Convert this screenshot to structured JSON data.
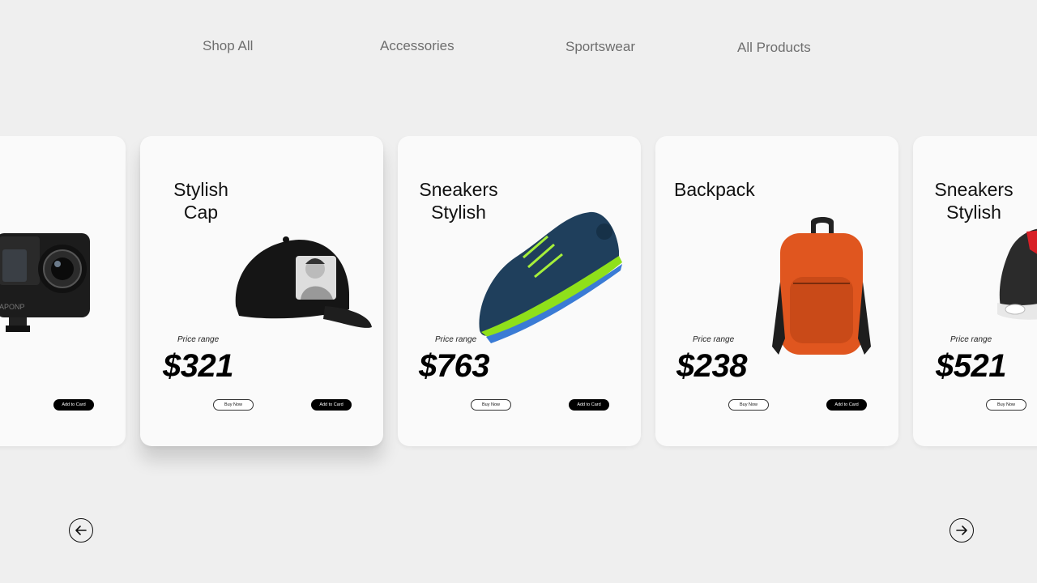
{
  "nav": {
    "items": [
      {
        "label": "Shop All"
      },
      {
        "label": "Accessories"
      },
      {
        "label": "Sportswear"
      },
      {
        "label": "All Products"
      }
    ]
  },
  "cards": [
    {
      "name": "Action Camera",
      "title_lines": [],
      "price_label": "",
      "price": "",
      "buy_label": "",
      "add_label": "Add to Card"
    },
    {
      "name": "Stylish Cap",
      "title_lines": [
        "Stylish",
        "Cap"
      ],
      "price_label": "Price range",
      "price": "$321",
      "buy_label": "Buy Now",
      "add_label": "Add to Card"
    },
    {
      "name": "Sneakers Stylish",
      "title_lines": [
        "Sneakers",
        "Stylish"
      ],
      "price_label": "Price range",
      "price": "$763",
      "buy_label": "Buy Now",
      "add_label": "Add to Card"
    },
    {
      "name": "Backpack",
      "title_lines": [
        "Backpack"
      ],
      "price_label": "Price range",
      "price": "$238",
      "buy_label": "Buy Now",
      "add_label": "Add to Card"
    },
    {
      "name": "Sneakers Stylish",
      "title_lines": [
        "Sneakers",
        "Stylish"
      ],
      "price_label": "Price range",
      "price": "$521",
      "buy_label": "Buy Now",
      "add_label": ""
    }
  ],
  "icons": {
    "prev": "arrow-left-icon",
    "next": "arrow-right-icon"
  },
  "colors": {
    "background": "#efefef",
    "card": "#fafafa",
    "primary_button": "#000000",
    "backpack": "#e0561f",
    "sneaker_body": "#1f3f5c",
    "sneaker_sole": "#8fe01a"
  }
}
